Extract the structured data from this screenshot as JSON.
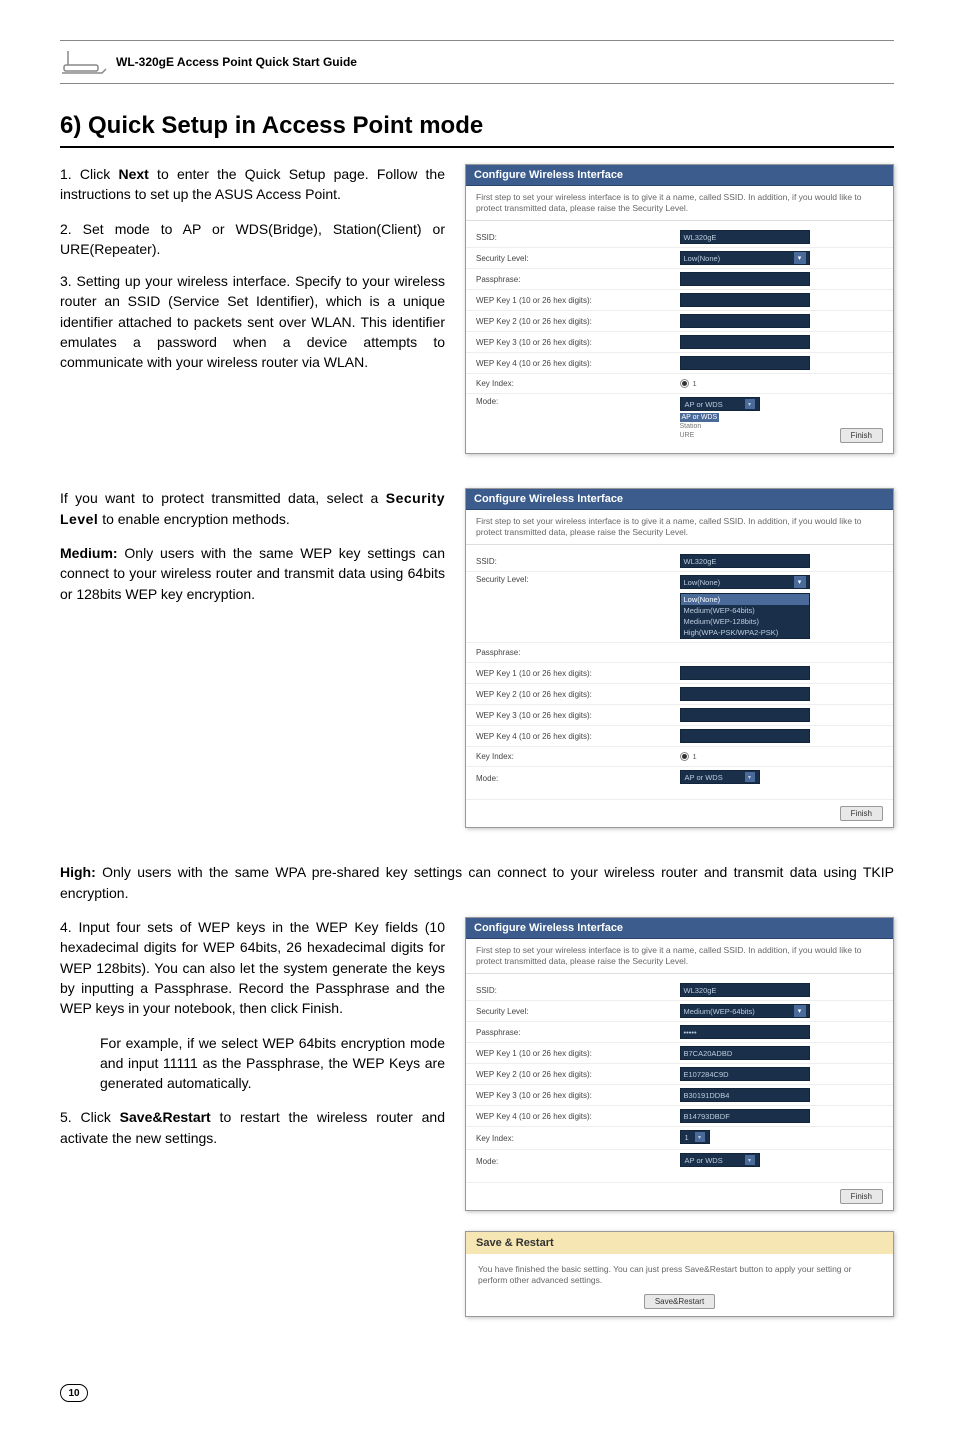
{
  "header": {
    "product_title": "WL-320gE Access Point Quick Start Guide"
  },
  "section": {
    "title": "6) Quick Setup in Access Point mode"
  },
  "body": {
    "step1": "1. Click Next to enter the Quick Setup page. Follow the instructions to set up the ASUS Access Point.",
    "step1_bold": "Next",
    "step2": "2. Set mode to AP or WDS(Bridge), Station(Client) or URE(Repeater).",
    "step3": "3. Setting up your wireless interface. Specify to your wireless router an SSID (Service Set Identifier), which is a unique identifier attached to packets sent over WLAN. This identifier emulates a password when a device attempts to communicate with your wireless router via WLAN.",
    "protect_para": "If you want to protect transmitted data, select a Security Level to enable encryption methods.",
    "protect_bold": "Security Level",
    "medium_label": "Medium:",
    "medium_text": " Only users with the same WEP key settings can connect to your wireless router and transmit data using 64bits or 128bits WEP key encryption.",
    "high_label": "High:",
    "high_text": " Only users with the same WPA pre-shared key settings can connect to your wireless router and transmit data using TKIP encryption.",
    "step4": "4. Input four sets of WEP keys in the WEP Key fields (10 hexadecimal digits for WEP 64bits, 26 hexadecimal digits for WEP 128bits). You can also let the system generate the keys by inputting a Passphrase. Record the Passphrase and the WEP keys in your notebook, then click Finish.",
    "step4_note": "For example, if we select WEP 64bits encryption mode and input 11111 as the Passphrase, the WEP Keys are generated automatically.",
    "step5": "5. Click Save&Restart to restart the wireless router and activate the new settings.",
    "step5_bold": "Save&Restart"
  },
  "ss1": {
    "title": "Configure Wireless Interface",
    "desc": "First step to set your wireless interface is to give it a name, called SSID. In addition, if you would like to protect transmitted data, please raise the Security Level.",
    "ssid_label": "SSID:",
    "ssid_value": "WL320gE",
    "sec_label": "Security Level:",
    "sec_value": "Low(None)",
    "pass_label": "Passphrase:",
    "wep1": "WEP Key 1 (10 or 26 hex digits):",
    "wep2": "WEP Key 2 (10 or 26 hex digits):",
    "wep3": "WEP Key 3 (10 or 26 hex digits):",
    "wep4": "WEP Key 4 (10 or 26 hex digits):",
    "key_index": "Key Index:",
    "key_index_val": "1",
    "mode_label": "Mode:",
    "mode_value": "AP or WDS",
    "mode_opt1": "AP or WDS",
    "mode_opt2": "Station",
    "mode_opt3": "URE",
    "finish": "Finish"
  },
  "ss2": {
    "title": "Configure Wireless Interface",
    "desc": "First step to set your wireless interface is to give it a name, called SSID. In addition, if you would like to protect transmitted data, please raise the Security Level.",
    "ssid_label": "SSID:",
    "ssid_value": "WL320gE",
    "sec_label": "Security Level:",
    "sec_value": "Low(None)",
    "sec_open1": "Low(None)",
    "sec_open2": "Medium(WEP-64bits)",
    "sec_open3": "Medium(WEP-128bits)",
    "sec_open4": "High(WPA-PSK/WPA2-PSK)",
    "pass_label": "Passphrase:",
    "wep1": "WEP Key 1 (10 or 26 hex digits):",
    "wep2": "WEP Key 2 (10 or 26 hex digits):",
    "wep3": "WEP Key 3 (10 or 26 hex digits):",
    "wep4": "WEP Key 4 (10 or 26 hex digits):",
    "key_index": "Key Index:",
    "key_index_val": "1",
    "mode_label": "Mode:",
    "mode_value": "AP or WDS",
    "finish": "Finish"
  },
  "ss3": {
    "title": "Configure Wireless Interface",
    "desc": "First step to set your wireless interface is to give it a name, called SSID. In addition, if you would like to protect transmitted data, please raise the Security Level.",
    "ssid_label": "SSID:",
    "ssid_value": "WL320gE",
    "sec_label": "Security Level:",
    "sec_value": "Medium(WEP-64bits)",
    "pass_label": "Passphrase:",
    "pass_value": "•••••",
    "wep1": "WEP Key 1 (10 or 26 hex digits):",
    "wep1v": "B7CA20ADBD",
    "wep2": "WEP Key 2 (10 or 26 hex digits):",
    "wep2v": "E107284C9D",
    "wep3": "WEP Key 3 (10 or 26 hex digits):",
    "wep3v": "B30191DDB4",
    "wep4": "WEP Key 4 (10 or 26 hex digits):",
    "wep4v": "B14793DBDF",
    "key_index": "Key Index:",
    "key_index_val": "1",
    "mode_label": "Mode:",
    "mode_value": "AP or WDS",
    "finish": "Finish"
  },
  "ss4": {
    "title": "Save & Restart",
    "desc": "You have finished the basic setting. You can just press Save&Restart button to apply your setting or perform other advanced settings.",
    "button": "Save&Restart"
  },
  "page_number": "10"
}
